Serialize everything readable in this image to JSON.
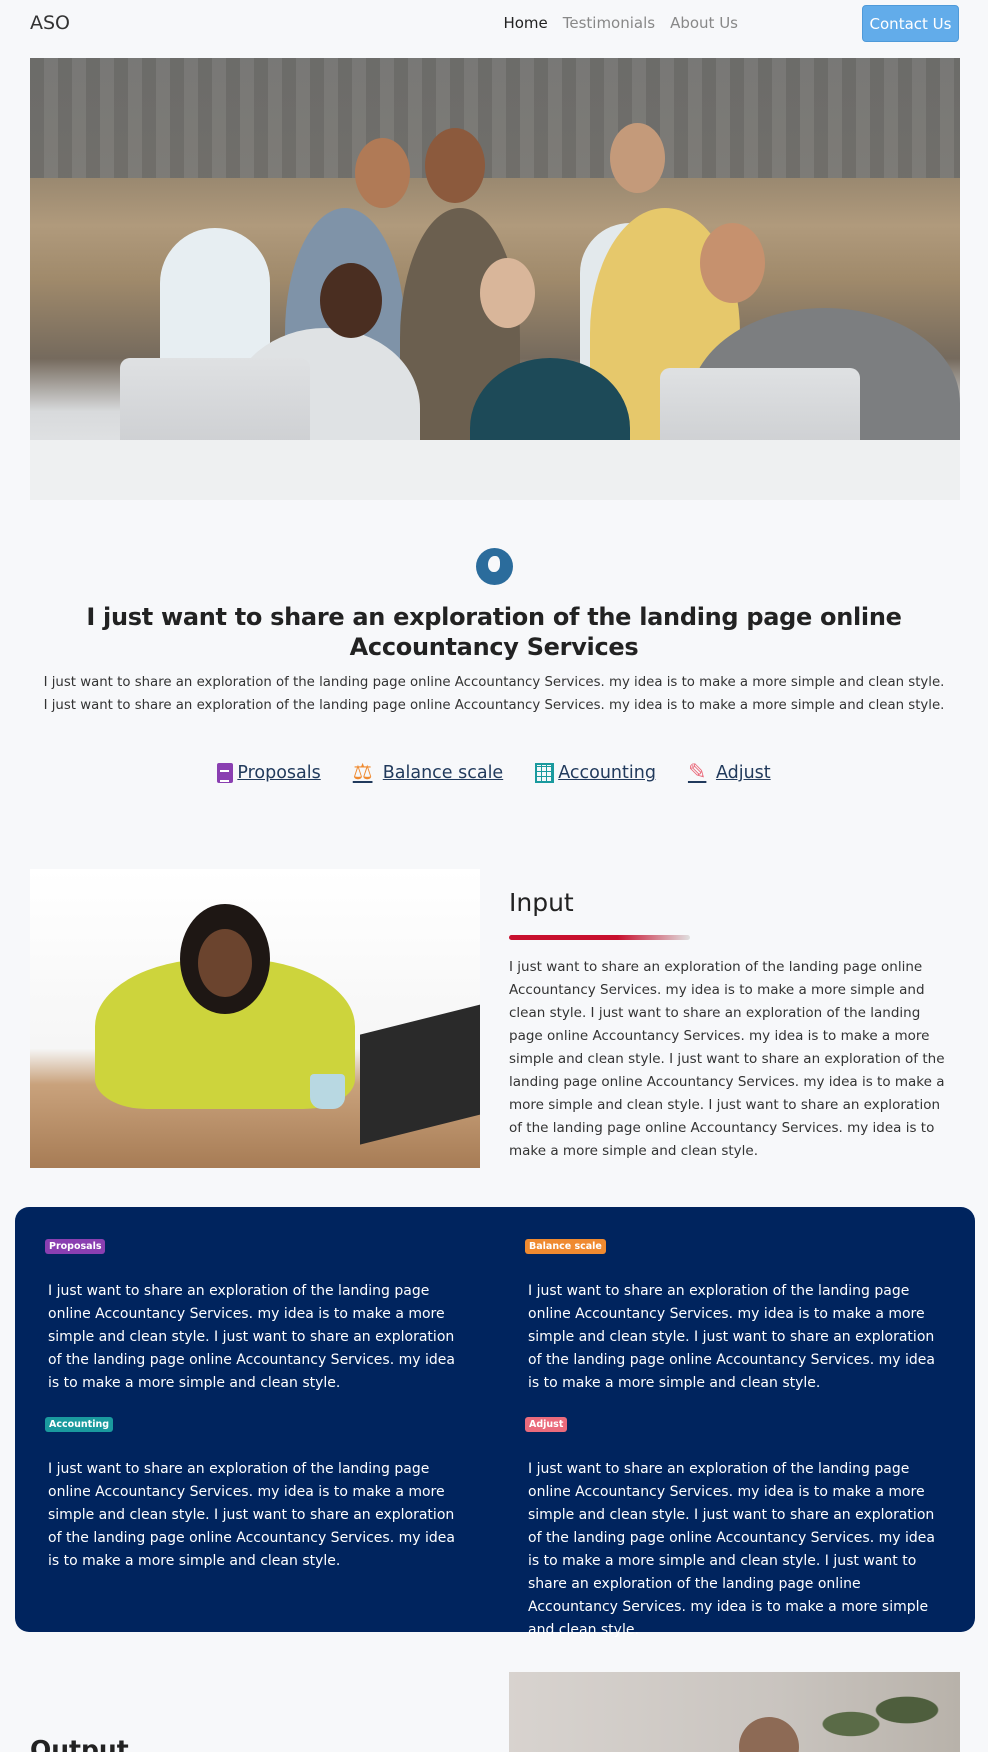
{
  "nav": {
    "brand": "ASO",
    "links": [
      "Home",
      "Testimonials",
      "About Us"
    ],
    "contact": "Contact Us"
  },
  "intro": {
    "icon": "globe-icon",
    "title": "I just want to share an exploration of the landing page online Accountancy Services",
    "text": "I just want to share an exploration of the landing page online Accountancy Services. my idea is to make a more simple and clean style. I just want to share an exploration of the landing page online Accountancy Services. my idea is to make a more simple and clean style."
  },
  "features": [
    {
      "label": "Proposals",
      "icon": "file-icon",
      "color": "#8a3fb1"
    },
    {
      "label": "Balance scale",
      "icon": "balance-scale-icon",
      "color": "#ef8a30"
    },
    {
      "label": "Accounting",
      "icon": "calculator-icon",
      "color": "#1a9a9e"
    },
    {
      "label": "Adjust",
      "icon": "pencil-icon",
      "color": "#ea6b7c"
    }
  ],
  "input": {
    "title": "Input",
    "text": "I just want to share an exploration of the landing page online Accountancy Services. my idea is to make a more simple and clean style. I just want to share an exploration of the landing page online Accountancy Services. my idea is to make a more simple and clean style. I just want to share an exploration of the landing page online Accountancy Services. my idea is to make a more simple and clean style. I just want to share an exploration of the landing page online Accountancy Services. my idea is to make a more simple and clean style."
  },
  "panel": {
    "color": "#00245e",
    "items": [
      {
        "badge": "Proposals",
        "color": "#8a3fb1",
        "text": "I just want to share an exploration of the landing page online Accountancy Services. my idea is to make a more simple and clean style. I just want to share an exploration of the landing page online Accountancy Services. my idea is to make a more simple and clean style."
      },
      {
        "badge": "Balance scale",
        "color": "#ef8a30",
        "text": "I just want to share an exploration of the landing page online Accountancy Services. my idea is to make a more simple and clean style. I just want to share an exploration of the landing page online Accountancy Services. my idea is to make a more simple and clean style."
      },
      {
        "badge": "Accounting",
        "color": "#1a9a9e",
        "text": "I just want to share an exploration of the landing page online Accountancy Services. my idea is to make a more simple and clean style. I just want to share an exploration of the landing page online Accountancy Services. my idea is to make a more simple and clean style."
      },
      {
        "badge": "Adjust",
        "color": "#ea6b7c",
        "text": "I just want to share an exploration of the landing page online Accountancy Services. my idea is to make a more simple and clean style. I just want to share an exploration of the landing page online Accountancy Services. my idea is to make a more simple and clean style. I just want to share an exploration of the landing page online Accountancy Services. my idea is to make a more simple and clean style."
      }
    ]
  },
  "output": {
    "title": "Output"
  }
}
